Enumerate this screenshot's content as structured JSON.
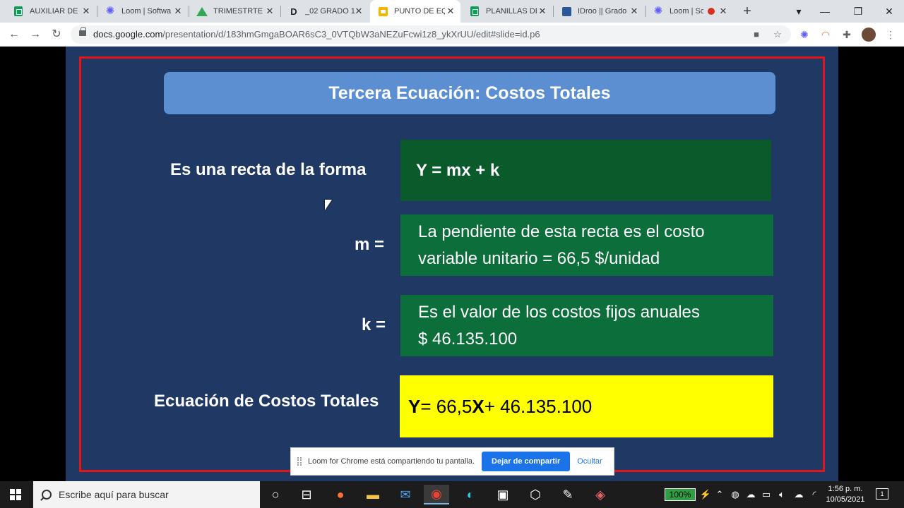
{
  "browser": {
    "tabs": [
      {
        "title": "AUXILIAR DE I",
        "icon": "sheets-icon"
      },
      {
        "title": "Loom | Softwa",
        "icon": "loom-icon"
      },
      {
        "title": "TRIMESTRTE I",
        "icon": "drive-icon"
      },
      {
        "title": "_02 GRADO 1",
        "icon": "d-icon"
      },
      {
        "title": "PUNTO DE EQ",
        "icon": "slides-icon",
        "active": true
      },
      {
        "title": "PLANILLAS DE",
        "icon": "sheets-icon"
      },
      {
        "title": "IDroo || Grado",
        "icon": "idroo-icon"
      },
      {
        "title": "Loom | Sc",
        "icon": "loom-icon",
        "recording": true
      }
    ],
    "url_host": "docs.google.com",
    "url_path": "/presentation/d/183hmGmgaBOAR6sC3_0VTQbW3aNEZuFcwi1z8_ykXrUU/edit#slide=id.p6"
  },
  "slide": {
    "title": "Tercera Ecuación: Costos Totales",
    "form_label": "Es una recta de la forma",
    "form_value": "Y = mx + k",
    "m_label": "m =",
    "m_line1": "La pendiente de esta recta es el costo",
    "m_line2": "variable unitario = 66,5 $/unidad",
    "k_label": "k =",
    "k_line1": "Es el valor de los costos fijos anuales",
    "k_line2": "$ 46.135.100",
    "eq_label": "Ecuación de Costos Totales",
    "eq_y": "Y",
    "eq_mid": " = 66,5",
    "eq_x": "X",
    "eq_end": " + 46.135.100"
  },
  "loom_bar": {
    "message": "Loom for Chrome está compartiendo tu pantalla.",
    "stop_button": "Dejar de compartir",
    "hide_link": "Ocultar"
  },
  "taskbar": {
    "search_placeholder": "Escribe aquí para buscar",
    "battery": "100%",
    "time": "1:56 p. m.",
    "date": "10/05/2021",
    "notifications": "1"
  },
  "colors": {
    "slide_bg": "#1f3864",
    "frame": "#e3151b",
    "header": "#5b8fd1",
    "green": "#0c6e3a",
    "yellow": "#ffff00"
  }
}
